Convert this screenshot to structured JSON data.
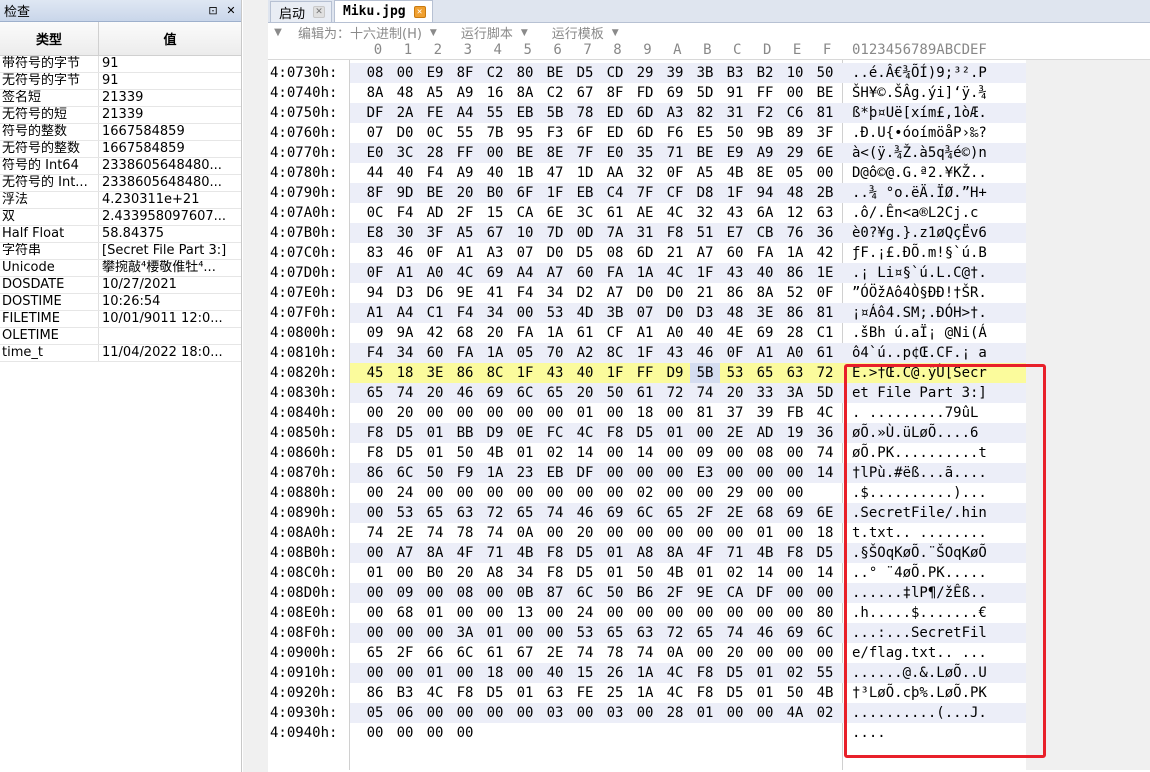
{
  "inspector": {
    "title": "检查",
    "pin_icon": "pin-icon",
    "close_icon": "close-icon",
    "col_type": "类型",
    "col_value": "值",
    "rows": [
      {
        "k": "带符号的字节",
        "v": "91"
      },
      {
        "k": "无符号的字节",
        "v": "91"
      },
      {
        "k": "签名短",
        "v": "21339"
      },
      {
        "k": "无符号的短",
        "v": "21339"
      },
      {
        "k": "符号的整数",
        "v": "1667584859"
      },
      {
        "k": "无符号的整数",
        "v": "1667584859"
      },
      {
        "k": "符号的 Int64",
        "v": "2338605648480..."
      },
      {
        "k": "无符号的 Int...",
        "v": "2338605648480..."
      },
      {
        "k": "浮法",
        "v": "4.230311e+21"
      },
      {
        "k": "双",
        "v": "2.433958097607..."
      },
      {
        "k": "Half Float",
        "v": "58.84375"
      },
      {
        "k": "字符串",
        "v": "[Secret File Part 3:]"
      },
      {
        "k": "Unicode",
        "v": "攀捥敲⁴楆敬倠牡⁴..."
      },
      {
        "k": "DOSDATE",
        "v": "10/27/2021"
      },
      {
        "k": "DOSTIME",
        "v": "10:26:54"
      },
      {
        "k": "FILETIME",
        "v": "10/01/9011 12:0..."
      },
      {
        "k": "OLETIME",
        "v": ""
      },
      {
        "k": "time_t",
        "v": "11/04/2022 18:0..."
      }
    ]
  },
  "tabs": [
    {
      "label": "启动",
      "active": false
    },
    {
      "label": "Miku.jpg",
      "active": true
    }
  ],
  "toolbar": {
    "edit_as_label": "编辑为：十六进制(H)",
    "run_script_label": "运行脚本",
    "run_template_label": "运行模板"
  },
  "columns": {
    "hex": [
      "0",
      "1",
      "2",
      "3",
      "4",
      "5",
      "6",
      "7",
      "8",
      "9",
      "A",
      "B",
      "C",
      "D",
      "E",
      "F"
    ],
    "ascii": "0123456789ABCDEF"
  },
  "hex_rows": [
    {
      "addr": "4:0730h:",
      "bytes": "08 00 E9 8F C2 80 BE D5 CD 29 39 3B B3 B2 10 50",
      "ascii": "..é.Â€¾ÕÍ)9;³².P"
    },
    {
      "addr": "4:0740h:",
      "bytes": "8A 48 A5 A9 16 8A C2 67 8F FD 69 5D 91 FF 00 BE",
      "ascii": "ŠH¥©.ŠÂg.ýi]‘ÿ.¾"
    },
    {
      "addr": "4:0750h:",
      "bytes": "DF 2A FE A4 55 EB 5B 78 ED 6D A3 82 31 F2 C6 81",
      "ascii": "ß*þ¤Uë[xím£‚1òÆ."
    },
    {
      "addr": "4:0760h:",
      "bytes": "07 D0 0C 55 7B 95 F3 6F ED 6D F6 E5 50 9B 89 3F",
      "ascii": ".Ð.U{•óoímöåP›‰?"
    },
    {
      "addr": "4:0770h:",
      "bytes": "E0 3C 28 FF 00 BE 8E 7F E0 35 71 BE E9 A9 29 6E",
      "ascii": "à<(ÿ.¾Ž.à5q¾é©)n"
    },
    {
      "addr": "4:0780h:",
      "bytes": "44 40 F4 A9 40 1B 47 1D AA 32 0F A5 4B 8E 05 00",
      "ascii": "D@ô©@.G.ª2.¥KŽ.."
    },
    {
      "addr": "4:0790h:",
      "bytes": "8F 9D BE 20 B0 6F 1F EB C4 7F CF D8 1F 94 48 2B",
      "ascii": "..¾ °o.ëÄ.ÏØ.”H+"
    },
    {
      "addr": "4:07A0h:",
      "bytes": "0C F4 AD 2F 15 CA 6E 3C 61 AE 4C 32 43 6A 12 63",
      "ascii": ".ô­/.Ên<a®L2Cj.c"
    },
    {
      "addr": "4:07B0h:",
      "bytes": "E8 30 3F A5 67 10 7D 0D 7A 31 F8 51 E7 CB 76 36",
      "ascii": "è0?¥g.}.z1øQçËv6"
    },
    {
      "addr": "4:07C0h:",
      "bytes": "83 46 0F A1 A3 07 D0 D5 08 6D 21 A7 60 FA 1A 42",
      "ascii": "ƒF.¡£.ÐÕ.m!§`ú.B"
    },
    {
      "addr": "4:07D0h:",
      "bytes": "0F A1 A0 4C 69 A4 A7 60 FA 1A 4C 1F 43 40 86 1E",
      "ascii": ".¡ Li¤§`ú.L.C@†."
    },
    {
      "addr": "4:07E0h:",
      "bytes": "94 D3 D6 9E 41 F4 34 D2 A7 D0 D0 21 86 8A 52 0F",
      "ascii": "”ÓÖžAô4Ò§ÐÐ!†ŠR."
    },
    {
      "addr": "4:07F0h:",
      "bytes": "A1 A4 C1 F4 34 00 53 4D 3B 07 D0 D3 48 3E 86 81",
      "ascii": "¡¤Áô4.SM;.ÐÓH>†."
    },
    {
      "addr": "4:0800h:",
      "bytes": "09 9A 42 68 20 FA 1A 61 CF A1 A0 40 4E 69 28 C1",
      "ascii": ".šBh ú.aÏ¡ @Ni(Á"
    },
    {
      "addr": "4:0810h:",
      "bytes": "F4 34 60 FA 1A 05 70 A2 8C 1F 43 46 0F A1 A0 61",
      "ascii": "ô4`ú..p¢Œ.CF.¡ a"
    },
    {
      "addr": "4:0820h:",
      "bytes": "45 18 3E 86 8C 1F 43 40 1F FF D9 5B 53 65 63 72",
      "ascii": "E.>†Œ.C@.ÿÙ[Secr"
    },
    {
      "addr": "4:0830h:",
      "bytes": "65 74 20 46 69 6C 65 20 50 61 72 74 20 33 3A 5D",
      "ascii": "et File Part 3:]"
    },
    {
      "addr": "4:0840h:",
      "bytes": "00 20 00 00 00 00 00 01 00 18 00 81 37 39 FB 4C",
      "ascii": ". .........79ûL"
    },
    {
      "addr": "4:0850h:",
      "bytes": "F8 D5 01 BB D9 0E FC 4C F8 D5 01 00 2E AD 19 36",
      "ascii": "øÕ.»Ù.üLøÕ...­.6"
    },
    {
      "addr": "4:0860h:",
      "bytes": "F8 D5 01 50 4B 01 02 14 00 14 00 09 00 08 00 74",
      "ascii": "øÕ.PK..........t"
    },
    {
      "addr": "4:0870h:",
      "bytes": "86 6C 50 F9 1A 23 EB DF 00 00 00 E3 00 00 00 14",
      "ascii": "†lPù.#ëß...ã...."
    },
    {
      "addr": "4:0880h:",
      "bytes": "00 24 00 00 00 00 00 00 00 02 00 00 29 00 00",
      "ascii": ".$..........)..."
    },
    {
      "addr": "4:0890h:",
      "bytes": "00 53 65 63 72 65 74 46 69 6C 65 2F 2E 68 69 6E",
      "ascii": ".SecretFile/.hin"
    },
    {
      "addr": "4:08A0h:",
      "bytes": "74 2E 74 78 74 0A 00 20 00 00 00 00 00 01 00 18",
      "ascii": "t.txt.. ........"
    },
    {
      "addr": "4:08B0h:",
      "bytes": "00 A7 8A 4F 71 4B F8 D5 01 A8 8A 4F 71 4B F8 D5",
      "ascii": ".§ŠOqKøÕ.¨ŠOqKøÕ"
    },
    {
      "addr": "4:08C0h:",
      "bytes": "01 00 B0 20 A8 34 F8 D5 01 50 4B 01 02 14 00 14",
      "ascii": "..° ¨4øÕ.PK....."
    },
    {
      "addr": "4:08D0h:",
      "bytes": "00 09 00 08 00 0B 87 6C 50 B6 2F 9E CA DF 00 00",
      "ascii": "......‡lP¶/žÊß.."
    },
    {
      "addr": "4:08E0h:",
      "bytes": "00 68 01 00 00 13 00 24 00 00 00 00 00 00 00 80",
      "ascii": ".h.....$.......€"
    },
    {
      "addr": "4:08F0h:",
      "bytes": "00 00 00 3A 01 00 00 53 65 63 72 65 74 46 69 6C",
      "ascii": "...:...SecretFil"
    },
    {
      "addr": "4:0900h:",
      "bytes": "65 2F 66 6C 61 67 2E 74 78 74 0A 00 20 00 00 00",
      "ascii": "e/flag.txt.. ..."
    },
    {
      "addr": "4:0910h:",
      "bytes": "00 00 01 00 18 00 40 15 26 1A 4C F8 D5 01 02 55",
      "ascii": "......@.&.LøÕ..U"
    },
    {
      "addr": "4:0920h:",
      "bytes": "86 B3 4C F8 D5 01 63 FE 25 1A 4C F8 D5 01 50 4B",
      "ascii": "†³LøÕ.cþ%.LøÕ.PK"
    },
    {
      "addr": "4:0930h:",
      "bytes": "05 06 00 00 00 00 03 00 03 00 28 01 00 00 4A 02",
      "ascii": "..........(...J."
    },
    {
      "addr": "4:0940h:",
      "bytes": "00 00 00 00",
      "ascii": "...."
    }
  ],
  "selected_row": "4:0820h:",
  "cursor_byte": "5B",
  "colors": {
    "selection": "#fbfb9c",
    "alt_row": "#eceef8",
    "annotation": "#e8202a"
  }
}
